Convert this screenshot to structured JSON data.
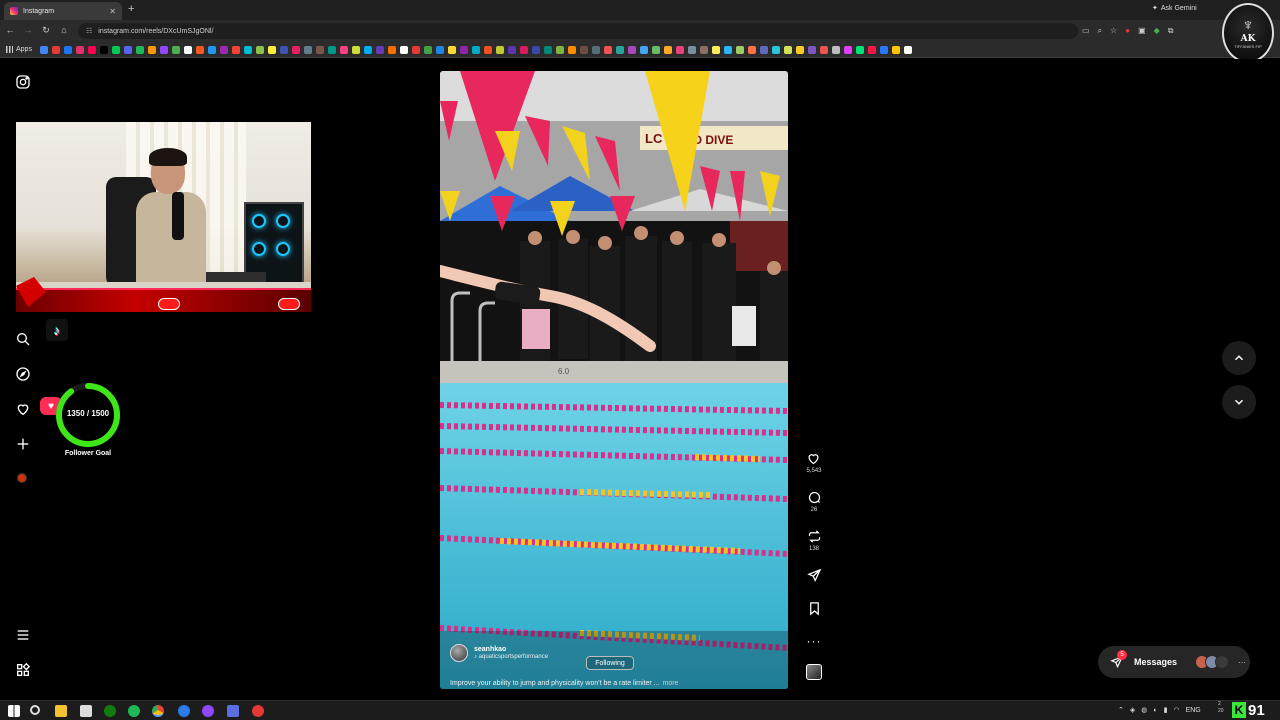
{
  "browser": {
    "tab_title": "Instagram",
    "url": "instagram.com/reels/DXcUmSJgONl/",
    "ask_gemini": "Ask Gemini",
    "bookmarks_apps_label": "Apps",
    "bookmark_colors": [
      "#4285f4",
      "#e53935",
      "#1877f2",
      "#e1306c",
      "#ff0050",
      "#000000",
      "#00c853",
      "#5865f2",
      "#1db954",
      "#ff9800",
      "#9146ff",
      "#4caf50",
      "#ffffff",
      "#ff5722",
      "#2196f3",
      "#9c27b0",
      "#f44336",
      "#00bcd4",
      "#8bc34a",
      "#ffeb3b",
      "#3f51b5",
      "#e91e63",
      "#607d8b",
      "#795548",
      "#009688",
      "#ff4081",
      "#cddc39",
      "#03a9f4",
      "#673ab7",
      "#ff6f00",
      "#ffffff",
      "#e53935",
      "#43a047",
      "#1e88e5",
      "#fdd835",
      "#8e24aa",
      "#00acc1",
      "#f4511e",
      "#c0ca33",
      "#5e35b1",
      "#d81b60",
      "#3949ab",
      "#00897b",
      "#7cb342",
      "#fb8c00",
      "#6d4c41",
      "#546e7a",
      "#ef5350",
      "#26a69a",
      "#ab47bc",
      "#42a5f5",
      "#66bb6a",
      "#ffa726",
      "#ec407a",
      "#78909c",
      "#8d6e63",
      "#ffee58",
      "#29b6f6",
      "#9ccc65",
      "#ff7043",
      "#5c6bc0",
      "#26c6da",
      "#d4e157",
      "#ffca28",
      "#7e57c2",
      "#ef5350",
      "#bdbdbd",
      "#e040fb",
      "#00e676",
      "#ff1744",
      "#2979ff",
      "#ffc400",
      "#ffffff"
    ]
  },
  "logo_badge": {
    "text": "AK",
    "subtext": "TIFFANIES FIP"
  },
  "sidebar": {
    "icons": [
      "instagram-icon",
      "search-icon",
      "explore-icon",
      "heart-icon",
      "create-icon",
      "profile-icon",
      "menu-icon",
      "more-icon"
    ]
  },
  "follower_goal": {
    "current": 1350,
    "target": 1500,
    "text": "1350 / 1500",
    "label": "Follower Goal",
    "progress_fraction": 0.9,
    "ring_color": "#3ee619"
  },
  "reel": {
    "author": "seanhkao",
    "collaborator": "aquaticsportsperformance",
    "follow_label": "Following",
    "caption": "Improve your ability to jump and physicality won't be a rate limiter ...",
    "more_label": "more",
    "banner_text": "AND DIVE",
    "banner_logo": "LC",
    "pool_depth": "6.0",
    "likes": "5,543",
    "comments": "26",
    "reposts": "138"
  },
  "messages": {
    "label": "Messages",
    "badge": "5"
  },
  "taskbar": {
    "tray_lang": "ENG",
    "stat_letter": "K",
    "stat_number": "91",
    "clock_time": "2",
    "clock_date": "20"
  }
}
